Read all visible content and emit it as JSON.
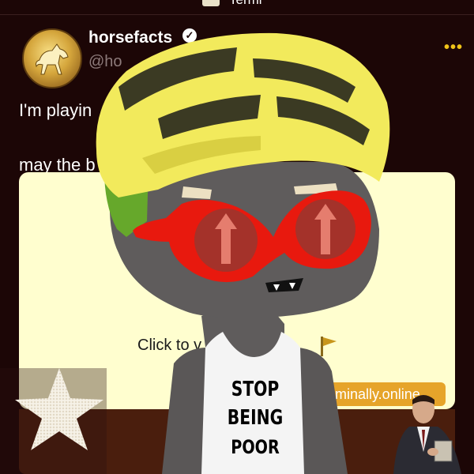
{
  "header": {
    "tab_label": "Termi"
  },
  "post": {
    "display_name": "horsefacts",
    "verified_glyph": "✓",
    "handle": "@ho",
    "more_glyph": "•••",
    "text_line1": "I'm playin",
    "text_line2": "may the b",
    "card": {
      "cta_text": "Click to v      flag",
      "flag_icon": "flag-icon",
      "link_text": "erminally.online"
    }
  },
  "overlay": {
    "shirt_lines": [
      "STOP",
      "BEING",
      "POOR"
    ]
  },
  "colors": {
    "background": "#1c0606",
    "card": "#fffecf",
    "accent": "#f0c419",
    "link_pill": "#e6a42a",
    "card_bottom": "#4a1e0d",
    "helmet": "#f2ea5c",
    "glasses": "#e8190e",
    "skin": "#5f5c5c"
  }
}
